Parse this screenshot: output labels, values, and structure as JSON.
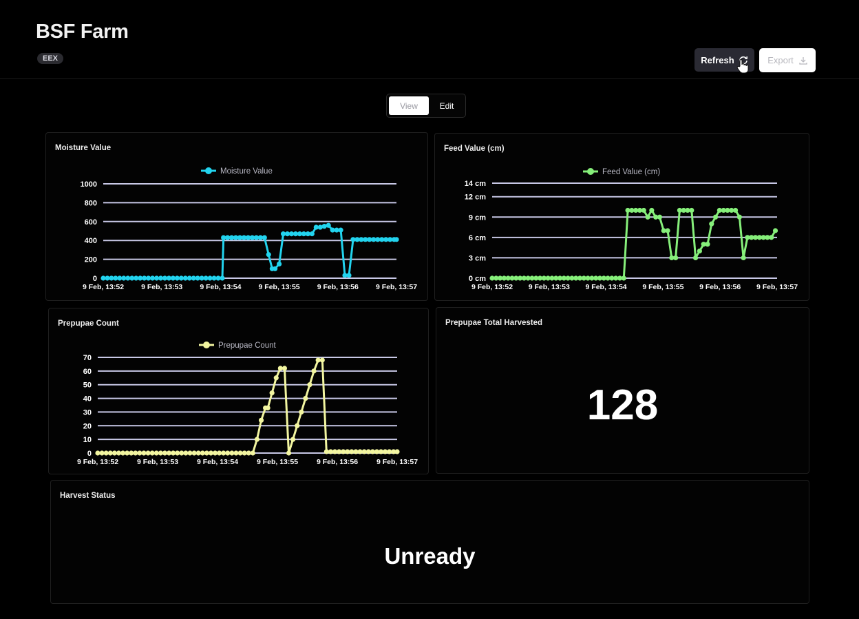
{
  "header": {
    "title": "BSF Farm",
    "badge": "EEX",
    "refresh_label": "Refresh",
    "export_label": "Export",
    "refresh_icon": "refresh-icon",
    "export_icon": "download-icon"
  },
  "mode_toggle": {
    "view_label": "View",
    "edit_label": "Edit",
    "selected": "View"
  },
  "panels": {
    "moisture": {
      "title": "Moisture Value"
    },
    "feed": {
      "title": "Feed Value (cm)"
    },
    "prepupae": {
      "title": "Prepupae Count"
    },
    "total": {
      "title": "Prepupae Total Harvested",
      "value": "128"
    },
    "status": {
      "title": "Harvest Status",
      "value": "Unready"
    }
  },
  "colors": {
    "background": "#000000",
    "moisture_series": "#22d3ee",
    "feed_series": "#86ef7a",
    "prepupae_series": "#f2f5a0",
    "gridline": "#c8c8e6"
  },
  "chart_data": [
    {
      "type": "line",
      "title": "Moisture Value",
      "xlabel": "",
      "ylabel": "",
      "x_tick_labels": [
        "9 Feb, 13:52",
        "9 Feb, 13:53",
        "9 Feb, 13:54",
        "9 Feb, 13:55",
        "9 Feb, 13:56",
        "9 Feb, 13:57"
      ],
      "y_tick_labels": [
        "0",
        "200",
        "400",
        "600",
        "800",
        "1000"
      ],
      "ylim": [
        0,
        1000
      ],
      "xlim": [
        0,
        5
      ],
      "legend": "top",
      "grid": true,
      "series": [
        {
          "name": "Moisture Value",
          "color": "#22d3ee",
          "x": [
            0,
            0.07,
            0.14,
            0.21,
            0.28,
            0.35,
            0.42,
            0.49,
            0.56,
            0.63,
            0.7,
            0.77,
            0.84,
            0.91,
            0.98,
            1.05,
            1.12,
            1.19,
            1.26,
            1.33,
            1.4,
            1.47,
            1.54,
            1.61,
            1.68,
            1.75,
            1.82,
            1.89,
            1.96,
            2.03,
            2.05,
            2.12,
            2.19,
            2.26,
            2.33,
            2.4,
            2.47,
            2.54,
            2.61,
            2.68,
            2.75,
            2.82,
            2.88,
            2.93,
            3.0,
            3.07,
            3.14,
            3.21,
            3.28,
            3.35,
            3.42,
            3.49,
            3.56,
            3.63,
            3.7,
            3.77,
            3.84,
            3.91,
            3.98,
            4.05,
            4.12,
            4.19,
            4.26,
            4.33,
            4.4,
            4.47,
            4.54,
            4.61,
            4.68,
            4.75,
            4.82,
            4.89,
            4.96,
            5.0
          ],
          "values": [
            0,
            0,
            0,
            0,
            0,
            0,
            0,
            0,
            0,
            0,
            0,
            0,
            0,
            0,
            0,
            0,
            0,
            0,
            0,
            0,
            0,
            0,
            0,
            0,
            0,
            0,
            0,
            0,
            0,
            0,
            430,
            430,
            430,
            430,
            430,
            430,
            430,
            430,
            430,
            430,
            430,
            250,
            100,
            100,
            150,
            470,
            470,
            470,
            470,
            470,
            470,
            470,
            470,
            540,
            540,
            550,
            560,
            510,
            510,
            510,
            30,
            30,
            410,
            410,
            410,
            410,
            410,
            410,
            410,
            410,
            410,
            410,
            410,
            410
          ]
        }
      ]
    },
    {
      "type": "line",
      "title": "Feed Value (cm)",
      "xlabel": "",
      "ylabel": "",
      "x_tick_labels": [
        "9 Feb, 13:52",
        "9 Feb, 13:53",
        "9 Feb, 13:54",
        "9 Feb, 13:55",
        "9 Feb, 13:56",
        "9 Feb, 13:57"
      ],
      "y_tick_labels": [
        "0 cm",
        "3 cm",
        "6 cm",
        "9 cm",
        "12 cm",
        "14 cm"
      ],
      "ylim": [
        0,
        14
      ],
      "xlim": [
        0,
        5
      ],
      "legend": "top",
      "grid": true,
      "series": [
        {
          "name": "Feed Value (cm)",
          "color": "#86ef7a",
          "x": [
            0,
            0.07,
            0.14,
            0.21,
            0.28,
            0.35,
            0.42,
            0.49,
            0.56,
            0.63,
            0.7,
            0.77,
            0.84,
            0.91,
            0.98,
            1.05,
            1.12,
            1.19,
            1.26,
            1.33,
            1.4,
            1.47,
            1.54,
            1.61,
            1.68,
            1.75,
            1.82,
            1.89,
            1.96,
            2.03,
            2.1,
            2.17,
            2.24,
            2.31,
            2.38,
            2.45,
            2.52,
            2.59,
            2.66,
            2.73,
            2.8,
            2.87,
            2.94,
            3.01,
            3.08,
            3.15,
            3.22,
            3.29,
            3.36,
            3.43,
            3.5,
            3.57,
            3.64,
            3.71,
            3.78,
            3.85,
            3.92,
            3.99,
            4.06,
            4.13,
            4.2,
            4.27,
            4.34,
            4.41,
            4.48,
            4.55,
            4.62,
            4.69,
            4.76,
            4.83,
            4.9,
            4.97
          ],
          "values": [
            0,
            0,
            0,
            0,
            0,
            0,
            0,
            0,
            0,
            0,
            0,
            0,
            0,
            0,
            0,
            0,
            0,
            0,
            0,
            0,
            0,
            0,
            0,
            0,
            0,
            0,
            0,
            0,
            0,
            0,
            0,
            0,
            0,
            0,
            10,
            10,
            10,
            10,
            10,
            9,
            10,
            9,
            9,
            7,
            7,
            3,
            3,
            10,
            10,
            10,
            10,
            3,
            4,
            5,
            5,
            8,
            9,
            10,
            10,
            10,
            10,
            10,
            9,
            3,
            6,
            6,
            6,
            6,
            6,
            6,
            6,
            7
          ]
        }
      ]
    },
    {
      "type": "line",
      "title": "Prepupae Count",
      "xlabel": "",
      "ylabel": "",
      "x_tick_labels": [
        "9 Feb, 13:52",
        "9 Feb, 13:53",
        "9 Feb, 13:54",
        "9 Feb, 13:55",
        "9 Feb, 13:56",
        "9 Feb, 13:57"
      ],
      "y_tick_labels": [
        "0",
        "10",
        "20",
        "30",
        "40",
        "50",
        "60",
        "70"
      ],
      "ylim": [
        0,
        70
      ],
      "xlim": [
        0,
        5
      ],
      "legend": "top",
      "grid": true,
      "series": [
        {
          "name": "Prepupae Count",
          "color": "#f2f5a0",
          "x": [
            0,
            0.07,
            0.14,
            0.21,
            0.28,
            0.35,
            0.42,
            0.49,
            0.56,
            0.63,
            0.7,
            0.77,
            0.84,
            0.91,
            0.98,
            1.05,
            1.12,
            1.19,
            1.26,
            1.33,
            1.4,
            1.47,
            1.54,
            1.61,
            1.68,
            1.75,
            1.82,
            1.89,
            1.96,
            2.03,
            2.1,
            2.17,
            2.24,
            2.31,
            2.38,
            2.45,
            2.52,
            2.59,
            2.66,
            2.73,
            2.8,
            2.84,
            2.91,
            2.98,
            3.05,
            3.12,
            3.19,
            3.26,
            3.33,
            3.4,
            3.47,
            3.54,
            3.61,
            3.68,
            3.75,
            3.82,
            3.89,
            3.96,
            4.03,
            4.1,
            4.17,
            4.24,
            4.31,
            4.38,
            4.45,
            4.52,
            4.59,
            4.66,
            4.73,
            4.8,
            4.87,
            4.94,
            5.0
          ],
          "values": [
            0,
            0,
            0,
            0,
            0,
            0,
            0,
            0,
            0,
            0,
            0,
            0,
            0,
            0,
            0,
            0,
            0,
            0,
            0,
            0,
            0,
            0,
            0,
            0,
            0,
            0,
            0,
            0,
            0,
            0,
            0,
            0,
            0,
            0,
            0,
            0,
            0,
            0,
            10,
            24,
            33,
            33,
            44,
            55,
            62,
            62,
            0,
            10,
            20,
            30,
            40,
            50,
            60,
            68,
            68,
            1,
            1,
            1,
            1,
            1,
            1,
            1,
            1,
            1,
            1,
            1,
            1,
            1,
            1,
            1,
            1,
            1,
            1
          ]
        }
      ]
    }
  ]
}
